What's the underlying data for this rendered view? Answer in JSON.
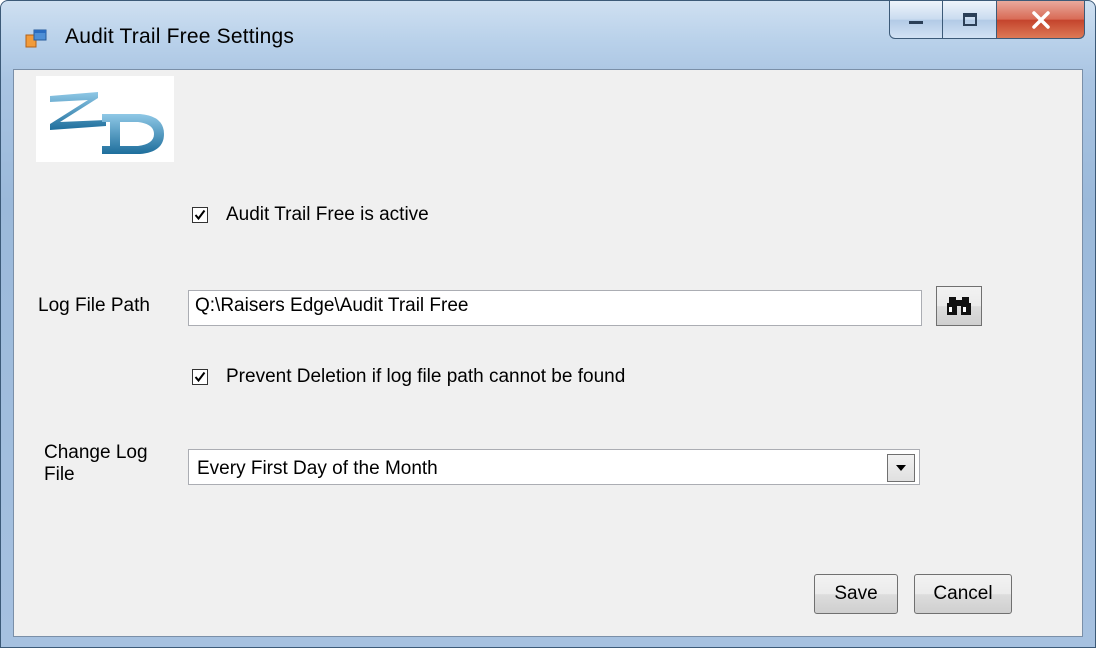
{
  "window": {
    "title": "Audit Trail Free Settings"
  },
  "logo": {
    "text": "ZD"
  },
  "settings": {
    "active_label": "Audit Trail Free is active",
    "active_checked": true,
    "log_path_label": "Log File Path",
    "log_path_value": "Q:\\Raisers Edge\\Audit Trail Free",
    "prevent_deletion_label": "Prevent Deletion if log file path cannot be found",
    "prevent_deletion_checked": true,
    "change_log_label_line1": "Change Log",
    "change_log_label_line2": "File",
    "change_log_value": "Every First Day of the Month"
  },
  "buttons": {
    "save": "Save",
    "cancel": "Cancel"
  },
  "icons": {
    "app": "form-icon",
    "browse": "binoculars-icon",
    "dropdown": "chevron-down-icon"
  }
}
